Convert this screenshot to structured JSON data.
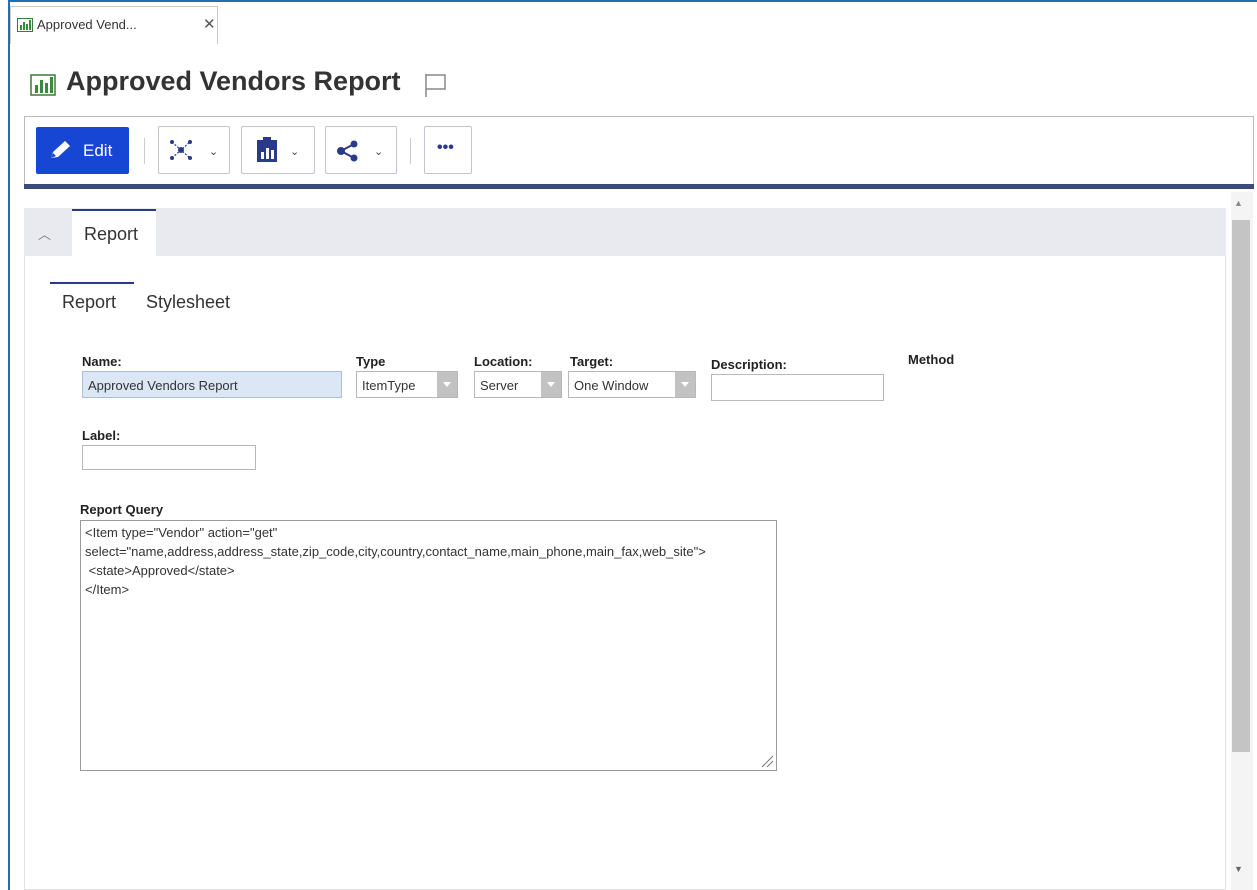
{
  "doc_tab": {
    "label": "Approved Vend...",
    "close": "✕"
  },
  "title": "Approved Vendors Report",
  "toolbar": {
    "edit_label": "Edit",
    "more_label": "•••"
  },
  "section": {
    "tab_label": "Report"
  },
  "inner_tabs": {
    "report": "Report",
    "stylesheet": "Stylesheet"
  },
  "form": {
    "name_label": "Name:",
    "name_value": "Approved Vendors Report",
    "type_label": "Type",
    "type_value": "ItemType",
    "location_label": "Location:",
    "location_value": "Server",
    "target_label": "Target:",
    "target_value": "One Window",
    "description_label": "Description:",
    "description_value": "",
    "method_label": "Method",
    "label_label": "Label:",
    "label_value": "",
    "query_label": "Report Query",
    "query_value": "<Item type=\"Vendor\" action=\"get\"\nselect=\"name,address,address_state,zip_code,city,country,contact_name,main_phone,main_fax,web_site\">\n <state>Approved</state>\n</Item>"
  },
  "colors": {
    "accent": "#1746d4",
    "frame": "#1e6fb5",
    "toolbar_bar": "#3a4a7a",
    "tab_indicator": "#2a3a8a"
  }
}
